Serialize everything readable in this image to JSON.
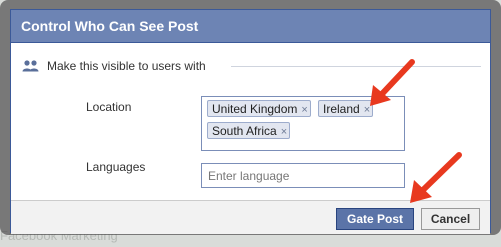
{
  "dialog": {
    "title": "Control Who Can See Post",
    "section_title": "Make this visible to users with",
    "location": {
      "label": "Location",
      "tokens": [
        "United Kingdom",
        "Ireland",
        "South Africa"
      ],
      "remove_glyph": "×"
    },
    "languages": {
      "label": "Languages",
      "placeholder": "Enter language"
    },
    "buttons": {
      "primary": "Gate Post",
      "cancel": "Cancel"
    }
  },
  "background": {
    "faded_text": "Facebook Marketing"
  },
  "colors": {
    "header_bg": "#6d84b4",
    "primary_button": "#5b74a8",
    "token_bg": "#e2e6f0",
    "annotation_arrow": "#e8391f"
  },
  "icons": [
    "users-icon",
    "remove-token-icon",
    "annotation-arrow"
  ]
}
